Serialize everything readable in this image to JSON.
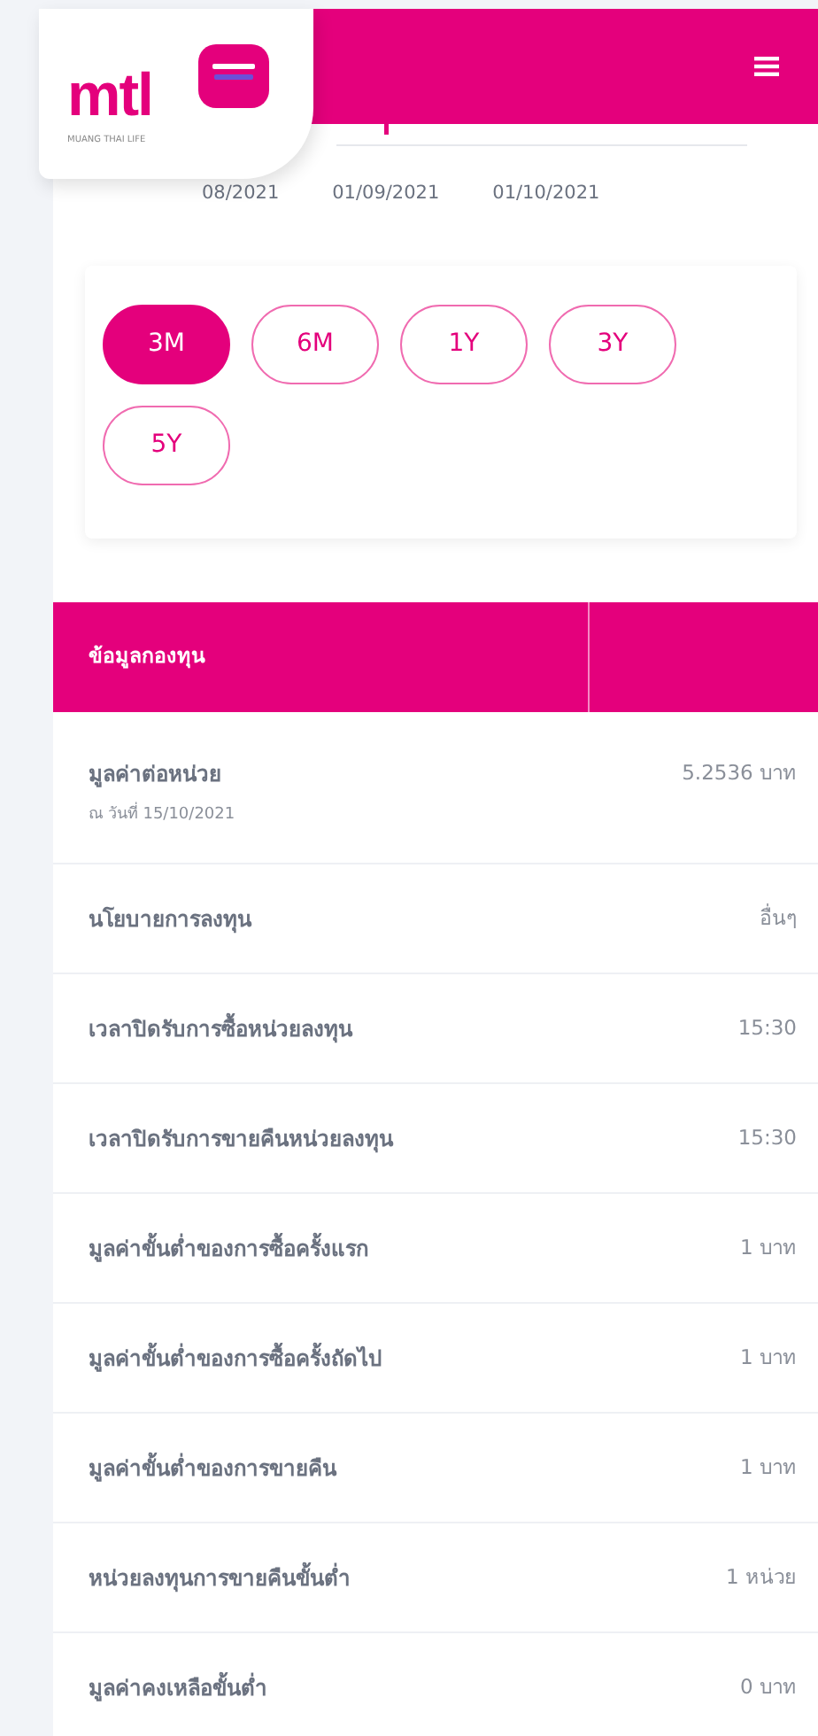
{
  "logo": {
    "wordmark": "mtl",
    "tagline": "MUANG THAI LIFE"
  },
  "chart_axis": {
    "labels": [
      "08/2021",
      "01/09/2021",
      "01/10/2021"
    ]
  },
  "periods": [
    {
      "label": "3M",
      "selected": true
    },
    {
      "label": "6M",
      "selected": false
    },
    {
      "label": "1Y",
      "selected": false
    },
    {
      "label": "3Y",
      "selected": false
    },
    {
      "label": "5Y",
      "selected": false
    }
  ],
  "fund_table": {
    "header": "ข้อมูลกองทุน",
    "rows": [
      {
        "label": "มูลค่าต่อหน่วย",
        "note": "ณ วันที่ 15/10/2021",
        "value": "5.2536 บาท"
      },
      {
        "label": "นโยบายการลงทุน",
        "value": "อื่นๆ"
      },
      {
        "label": "เวลาปิดรับการซื้อหน่วยลงทุน",
        "value": "15:30"
      },
      {
        "label": "เวลาปิดรับการขายคืนหน่วยลงทุน",
        "value": "15:30"
      },
      {
        "label": "มูลค่าขั้นต่ำของการซื้อครั้งแรก",
        "value": "1 บาท"
      },
      {
        "label": "มูลค่าขั้นต่ำของการซื้อครั้งถัดไป",
        "value": "1 บาท"
      },
      {
        "label": "มูลค่าขั้นต่ำของการขายคืน",
        "value": "1 บาท"
      },
      {
        "label": "หน่วยลงทุนการขายคืนขั้นต่ำ",
        "value": "1 หน่วย"
      },
      {
        "label": "มูลค่าคงเหลือขั้นต่ำ",
        "value": "0 บาท"
      }
    ]
  }
}
